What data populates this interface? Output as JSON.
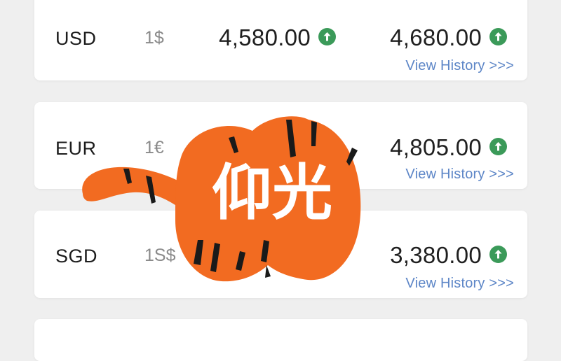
{
  "rates": [
    {
      "code": "USD",
      "unit": "1$",
      "buy": "4,580.00",
      "sell": "4,680.00",
      "history_link": "View History >>>"
    },
    {
      "code": "EUR",
      "unit": "1€",
      "buy": "",
      "sell": "4,805.00",
      "history_link": "View History >>>"
    },
    {
      "code": "SGD",
      "unit": "1S$",
      "buy": "",
      "sell": "3,380.00",
      "history_link": "View History >>>"
    }
  ],
  "trend_icon": "arrow-up-circle-icon",
  "watermark": {
    "text": "仰光",
    "colors": {
      "body": "#f26b21",
      "stripe": "#1a1a1a",
      "text": "#ffffff"
    }
  },
  "colors": {
    "trend_up": "#3b9a59",
    "link": "#5d86c7",
    "background": "#efefef",
    "card": "#ffffff"
  }
}
